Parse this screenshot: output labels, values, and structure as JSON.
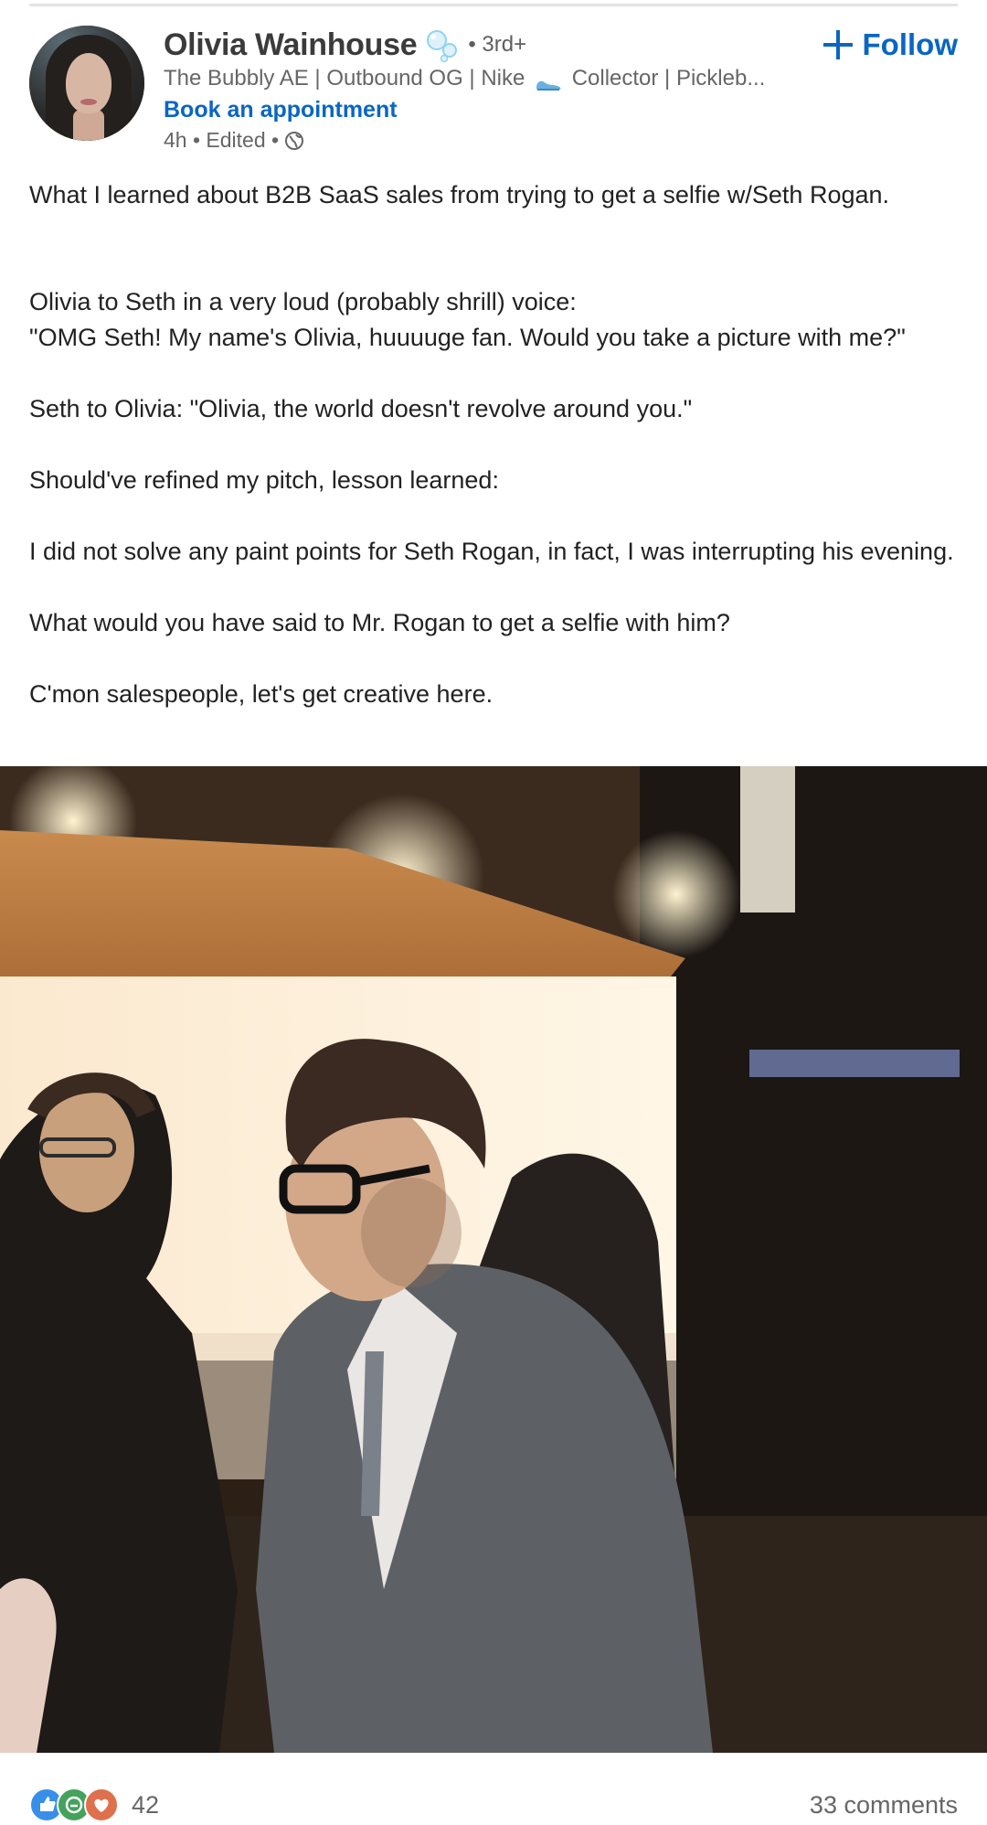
{
  "author": {
    "name": "Olivia Wainhouse",
    "degree": "• 3rd+",
    "headline_before": "The Bubbly AE | Outbound OG | Nike",
    "headline_after": "Collector | Pickleb...",
    "appointment_label": "Book an appointment",
    "meta": "4h • Edited •"
  },
  "follow_label": "Follow",
  "post": {
    "lines": [
      "What I learned about B2B SaaS sales from trying to get a selfie w/Seth Rogan.",
      "Olivia to Seth in a very loud (probably shrill) voice:",
      "\"OMG Seth! My name's Olivia, huuuuge fan. Would you take a picture with me?\"",
      "Seth to Olivia: \"Olivia, the world doesn't revolve around you.\"",
      "Should've refined my pitch, lesson learned:",
      "I did not solve any paint points for Seth Rogan, in fact, I was interrupting his evening.",
      "What would you have said to Mr. Rogan to get a selfie with him?",
      "C'mon salespeople, let's get creative here."
    ]
  },
  "social": {
    "reaction_count": "42",
    "comments_label": "33 comments"
  },
  "colors": {
    "accent": "#0a66c2",
    "text": "#191919",
    "muted": "#666666"
  },
  "icons": [
    "bubbles-icon",
    "shoe-icon",
    "globe-icon",
    "plus-icon",
    "like-icon",
    "celebrate-icon",
    "love-icon"
  ]
}
